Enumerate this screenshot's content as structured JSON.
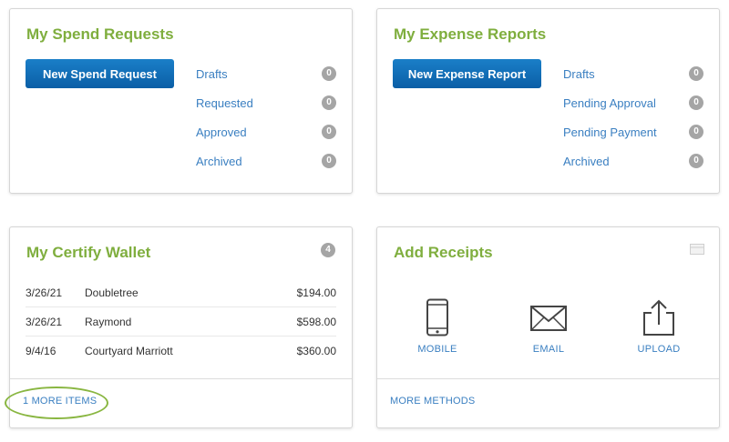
{
  "colors": {
    "title_green": "#7fae3e",
    "link_blue": "#3a7fc1",
    "button_blue": "#0b66b0",
    "badge_gray": "#a5a5a5",
    "highlight_green": "#89b641"
  },
  "spend_requests": {
    "title": "My Spend Requests",
    "button_label": "New Spend Request",
    "statuses": [
      {
        "label": "Drafts",
        "count": "0"
      },
      {
        "label": "Requested",
        "count": "0"
      },
      {
        "label": "Approved",
        "count": "0"
      },
      {
        "label": "Archived",
        "count": "0"
      }
    ]
  },
  "expense_reports": {
    "title": "My Expense Reports",
    "button_label": "New Expense Report",
    "statuses": [
      {
        "label": "Drafts",
        "count": "0"
      },
      {
        "label": "Pending Approval",
        "count": "0"
      },
      {
        "label": "Pending Payment",
        "count": "0"
      },
      {
        "label": "Archived",
        "count": "0"
      }
    ]
  },
  "wallet": {
    "title": "My Certify Wallet",
    "count": "4",
    "rows": [
      {
        "date": "3/26/21",
        "merchant": "Doubletree",
        "amount": "$194.00"
      },
      {
        "date": "3/26/21",
        "merchant": "Raymond",
        "amount": "$598.00"
      },
      {
        "date": "9/4/16",
        "merchant": "Courtyard Marriott",
        "amount": "$360.00"
      }
    ],
    "more_link": "1 MORE ITEMS"
  },
  "receipts": {
    "title": "Add Receipts",
    "methods": [
      {
        "label": "MOBILE",
        "icon": "mobile-phone-icon"
      },
      {
        "label": "EMAIL",
        "icon": "envelope-icon"
      },
      {
        "label": "UPLOAD",
        "icon": "upload-icon"
      }
    ],
    "more_link": "MORE METHODS",
    "collapse_icon": "card-toggle-icon"
  }
}
